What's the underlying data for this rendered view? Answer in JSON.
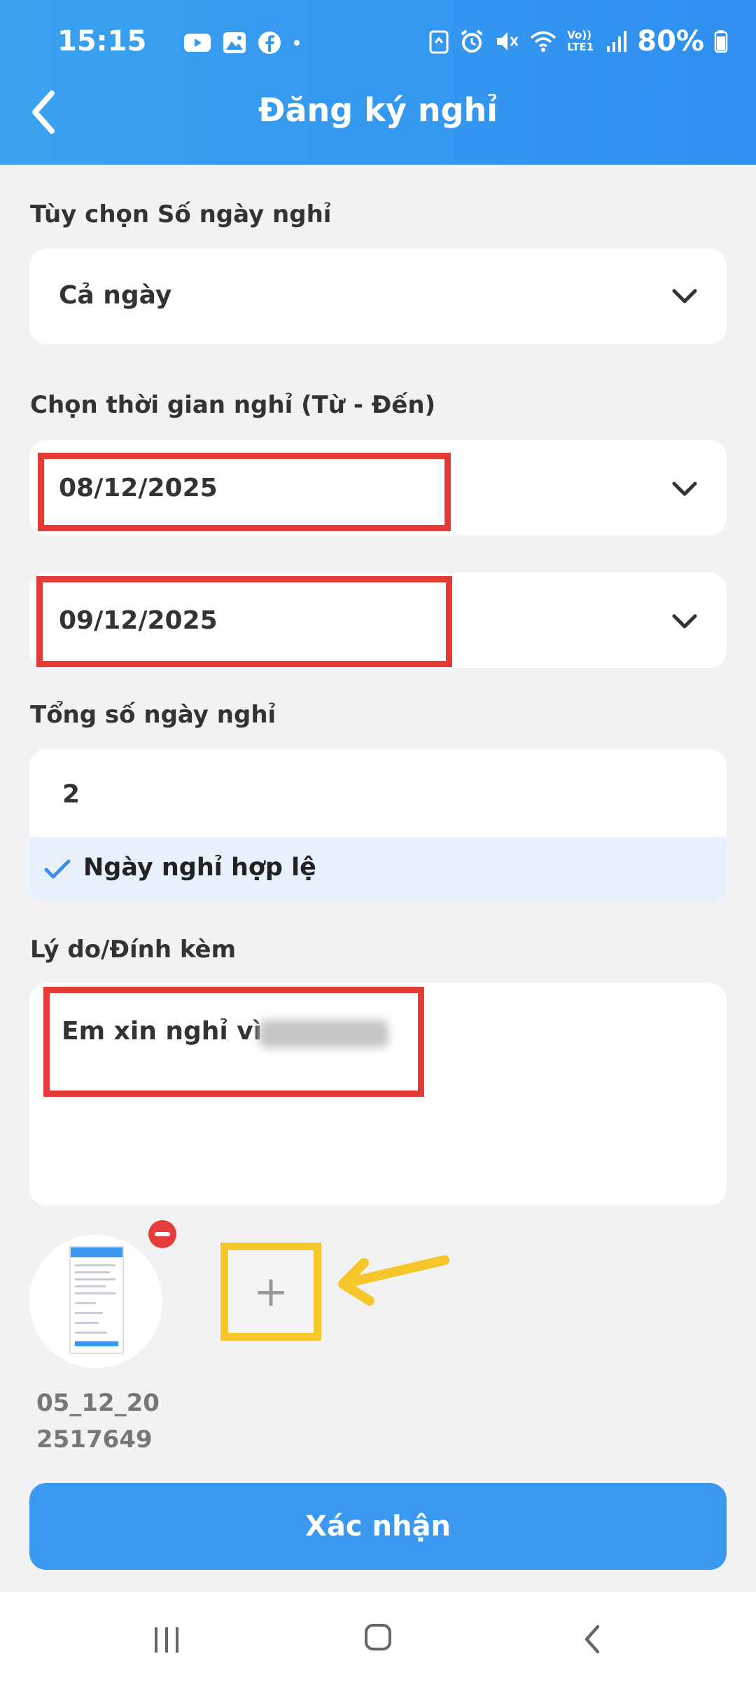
{
  "status_bar": {
    "time": "15:15",
    "network": "Vo)) LTE1",
    "battery": "80%"
  },
  "header": {
    "title": "Đăng ký nghỉ"
  },
  "form": {
    "day_option": {
      "label": "Tùy chọn Số ngày nghỉ",
      "value": "Cả ngày"
    },
    "time_range": {
      "label": "Chọn thời gian nghỉ (Từ - Đến)",
      "from": "08/12/2025",
      "to": "09/12/2025"
    },
    "total_days": {
      "label": "Tổng số ngày nghỉ",
      "value": "2",
      "validation": "Ngày nghỉ hợp lệ"
    },
    "reason": {
      "label": "Lý do/Đính kèm",
      "value": "Em xin nghỉ vì"
    },
    "attachment": {
      "filename": "05_12_20 2517649"
    }
  },
  "confirm_button": {
    "label": "Xác nhận"
  },
  "colors": {
    "header": "#3299ef",
    "accent": "#3a98ef",
    "highlight_red": "#e53b36",
    "highlight_yellow": "#f6c72a"
  }
}
